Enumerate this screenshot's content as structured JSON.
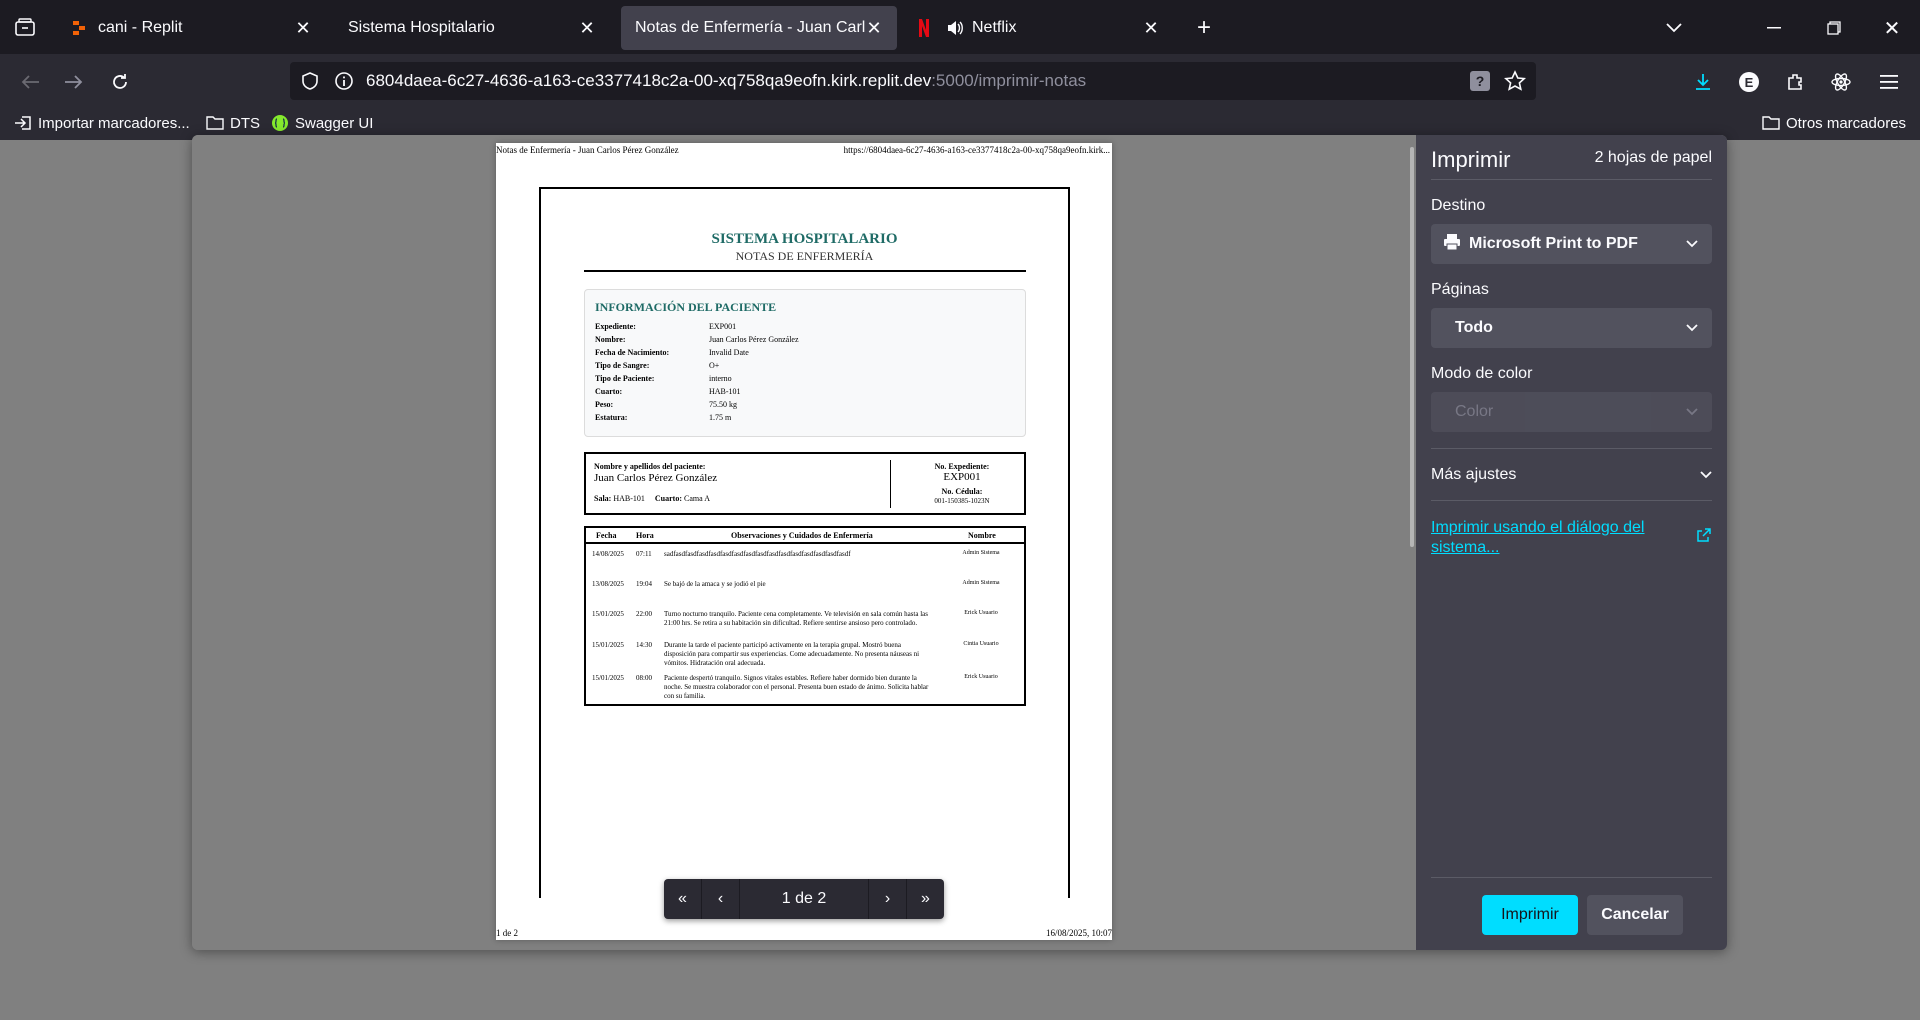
{
  "browser": {
    "tabs": [
      {
        "title": "cani - Replit",
        "icon": "replit-icon"
      },
      {
        "title": "Sistema Hospitalario",
        "icon": ""
      },
      {
        "title": "Notas de Enfermería - Juan Carlos Pérez González",
        "icon": ""
      },
      {
        "title": "Netflix",
        "icon": "netflix-icon"
      }
    ],
    "url_host": "6804daea-6c27-4636-a163-ce3377418c2a-00-xq758qa9eofn.kirk.replit.dev",
    "url_path": ":5000/imprimir-notas",
    "bookmarks": [
      "Importar marcadores...",
      "DTS",
      "Swagger UI"
    ],
    "other_bookmarks": "Otros marcadores",
    "accent": "#00ddff"
  },
  "print": {
    "title": "Imprimir",
    "sheets": "2 hojas de papel",
    "destination_label": "Destino",
    "destination_value": "Microsoft Print to PDF",
    "pages_label": "Páginas",
    "pages_value": "Todo",
    "color_label": "Modo de color",
    "color_value": "Color",
    "more_settings": "Más ajustes",
    "system_dialog_link": "Imprimir usando el diálogo del sistema...",
    "print_button": "Imprimir",
    "cancel_button": "Cancelar",
    "pager_label": "1 de 2"
  },
  "page": {
    "header_left": "Notas de Enfermería - Juan Carlos Pérez González",
    "header_right": "https://6804daea-6c27-4636-a163-ce3377418c2a-00-xq758qa9eofn.kirk...",
    "footer_left": "1 de 2",
    "footer_right": "16/08/2025, 10:07",
    "doc_title": "SISTEMA HOSPITALARIO",
    "doc_subtitle": "NOTAS DE ENFERMERÍA",
    "info_title": "INFORMACIÓN DEL PACIENTE",
    "info": [
      {
        "k": "Expediente:",
        "v": "EXP001"
      },
      {
        "k": "Nombre:",
        "v": "Juan Carlos Pérez González"
      },
      {
        "k": "Fecha de Nacimiento:",
        "v": "Invalid Date"
      },
      {
        "k": "Tipo de Sangre:",
        "v": "O+"
      },
      {
        "k": "Tipo de Paciente:",
        "v": "interno"
      },
      {
        "k": "Cuarto:",
        "v": "HAB-101"
      },
      {
        "k": "Peso:",
        "v": "75.50 kg"
      },
      {
        "k": "Estatura:",
        "v": "1.75 m"
      }
    ],
    "id_name_label": "Nombre y apellidos del paciente:",
    "id_name": "Juan Carlos Pérez González",
    "id_sala_label": "Sala:",
    "id_sala": "HAB-101",
    "id_cuarto_label": "Cuarto:",
    "id_cuarto": "Cama A",
    "id_exp_label": "No. Expediente:",
    "id_exp": "EXP001",
    "id_cedula_label": "No. Cédula:",
    "id_cedula": "001-150385-1023N",
    "table_headers": [
      "Fecha",
      "Hora",
      "Observaciones y Cuidados de Enfermería",
      "Nombre"
    ],
    "notes": [
      {
        "fecha": "14/08/2025",
        "hora": "07:11",
        "obs": "sadfasdfasdfasdfasdfasdfasdfasdfasdfasdfasdfasdfasdfasdfasdfasdf",
        "nombre": "Admin Sistema"
      },
      {
        "fecha": "13/08/2025",
        "hora": "19:04",
        "obs": "Se bajó de la amaca y se jodió el pie",
        "nombre": "Admin Sistema"
      },
      {
        "fecha": "15/01/2025",
        "hora": "22:00",
        "obs": "Turno nocturno tranquilo. Paciente cena completamente. Ve televisión en sala común hasta las 21:00 hrs. Se retira a su habitación sin dificultad. Refiere sentirse ansioso pero controlado.",
        "nombre": "Erick Usuario"
      },
      {
        "fecha": "15/01/2025",
        "hora": "14:30",
        "obs": "Durante la tarde el paciente participó activamente en la terapia grupal. Mostró buena disposición para compartir sus experiencias. Come adecuadamente. No presenta náuseas ni vómitos. Hidratación oral adecuada.",
        "nombre": "Cintia Usuario"
      },
      {
        "fecha": "15/01/2025",
        "hora": "08:00",
        "obs": "Paciente despertó tranquilo. Signos vitales estables. Refiere haber dormido bien durante la noche. Se muestra colaborador con el personal. Presenta buen estado de ánimo. Solicita hablar con su familia.",
        "nombre": "Erick Usuario"
      }
    ]
  }
}
